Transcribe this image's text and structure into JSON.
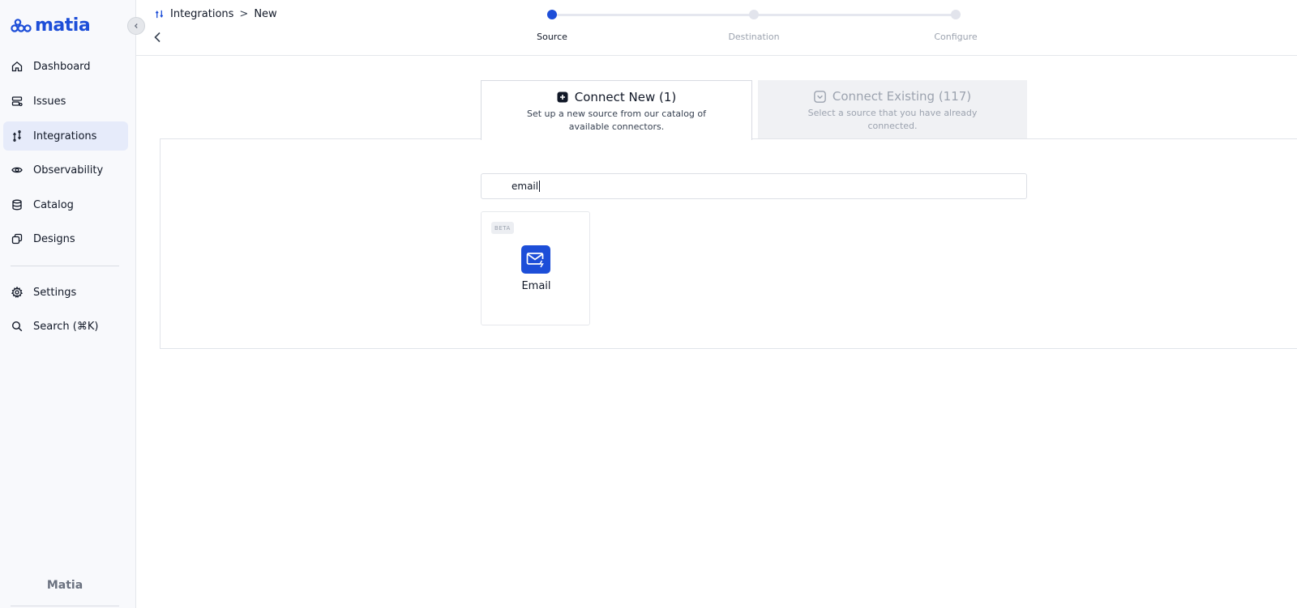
{
  "brand": {
    "name": "matia",
    "footer": "Matia",
    "accent": "#1d4ed8"
  },
  "sidebar": {
    "items": [
      {
        "label": "Dashboard",
        "icon": "home-icon"
      },
      {
        "label": "Issues",
        "icon": "issues-icon"
      },
      {
        "label": "Integrations",
        "icon": "integrations-icon",
        "active": true
      },
      {
        "label": "Observability",
        "icon": "eye-icon"
      },
      {
        "label": "Catalog",
        "icon": "database-icon"
      },
      {
        "label": "Designs",
        "icon": "designs-icon"
      }
    ],
    "bottom_items": [
      {
        "label": "Settings",
        "icon": "gear-icon"
      },
      {
        "label": "Search (⌘K)",
        "icon": "search-icon"
      }
    ]
  },
  "breadcrumb": {
    "section": "Integrations",
    "separator": ">",
    "page": "New"
  },
  "stepper": {
    "steps": [
      {
        "label": "Source",
        "active": true
      },
      {
        "label": "Destination",
        "active": false
      },
      {
        "label": "Configure",
        "active": false
      }
    ]
  },
  "tabs": {
    "new": {
      "title": "Connect New (1)",
      "description": "Set up a new source from our catalog of available connectors."
    },
    "existing": {
      "title": "Connect Existing (117)",
      "description": "Select a source that you have already connected."
    }
  },
  "search": {
    "value": "email"
  },
  "connectors": [
    {
      "badge": "BETA",
      "label": "Email",
      "icon": "email-icon"
    }
  ]
}
